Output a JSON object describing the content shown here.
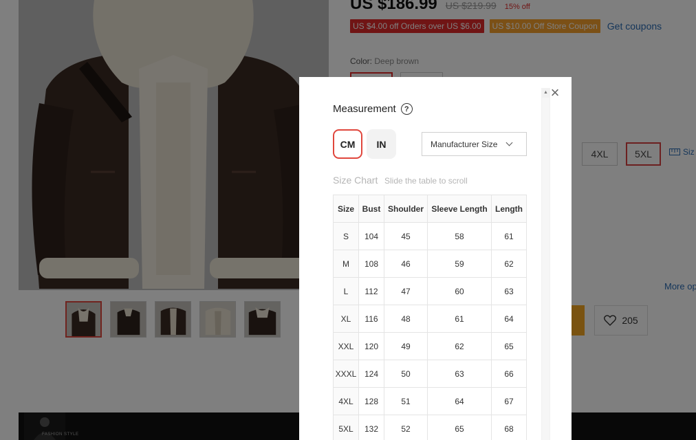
{
  "product": {
    "price": "US $186.99",
    "original_price": "US $219.99",
    "discount": "15% off",
    "coupons": [
      "US $4.00 off Orders over US $6.00",
      "US $10.00 Off Store Coupon"
    ],
    "get_coupons": "Get coupons",
    "color_label": "Color:",
    "color_value": "Deep brown",
    "sizes_visible": [
      "4XL",
      "5XL"
    ],
    "size_info_label": "Siz",
    "more_options": "More op",
    "wishlist_count": "205",
    "banner_text": "FASHION STYLE"
  },
  "colors": {
    "accent": "#e0463c",
    "link": "#2a6cb5",
    "buy": "#f5a623",
    "coupon_red": "#e02a2a",
    "coupon_orange": "#f7a12c"
  },
  "modal": {
    "title": "Measurement",
    "units": {
      "cm": "CM",
      "in": "IN",
      "selected": "CM"
    },
    "size_type": "Manufacturer Size",
    "chart_title": "Size Chart",
    "chart_hint": "Slide the table to scroll",
    "table": {
      "headers": [
        "Size",
        "Bust",
        "Shoulder",
        "Sleeve Length",
        "Length"
      ],
      "rows": [
        [
          "S",
          "104",
          "45",
          "58",
          "61"
        ],
        [
          "M",
          "108",
          "46",
          "59",
          "62"
        ],
        [
          "L",
          "112",
          "47",
          "60",
          "63"
        ],
        [
          "XL",
          "116",
          "48",
          "61",
          "64"
        ],
        [
          "XXL",
          "120",
          "49",
          "62",
          "65"
        ],
        [
          "XXXL",
          "124",
          "50",
          "63",
          "66"
        ],
        [
          "4XL",
          "128",
          "51",
          "64",
          "67"
        ],
        [
          "5XL",
          "132",
          "52",
          "65",
          "68"
        ]
      ]
    }
  }
}
